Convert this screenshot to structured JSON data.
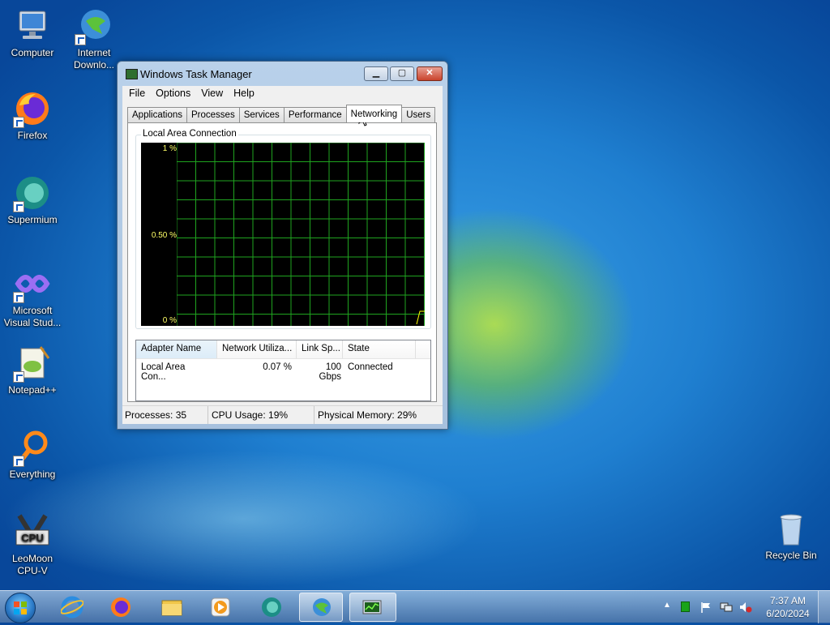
{
  "desktop": {
    "icons": [
      {
        "label": "Computer",
        "icon": "computer-icon"
      },
      {
        "label": "Internet Downlo...",
        "icon": "internet-download-manager-icon"
      },
      {
        "label": "Firefox",
        "icon": "firefox-icon"
      },
      {
        "label": "Supermium",
        "icon": "supermium-icon"
      },
      {
        "label": "Microsoft Visual Stud...",
        "icon": "visual-studio-icon"
      },
      {
        "label": "Notepad++",
        "icon": "notepad-plus-plus-icon"
      },
      {
        "label": "Everything",
        "icon": "everything-search-icon"
      },
      {
        "label": "LeoMoon CPU-V",
        "icon": "leomoon-cpu-v-icon"
      },
      {
        "label": "Recycle Bin",
        "icon": "recycle-bin-icon"
      }
    ]
  },
  "window": {
    "title": "Windows Task Manager",
    "menu": [
      "File",
      "Options",
      "View",
      "Help"
    ],
    "tabs": [
      "Applications",
      "Processes",
      "Services",
      "Performance",
      "Networking",
      "Users"
    ],
    "active_tab": "Networking",
    "graph": {
      "title": "Local Area Connection",
      "y_labels": [
        "1 %",
        "0.50 %",
        "0 %"
      ],
      "grid_color": "#1fa31f",
      "line_color": "#ffff00"
    },
    "adapters": {
      "columns": [
        "Adapter Name",
        "Network Utiliza...",
        "Link Sp...",
        "State"
      ],
      "rows": [
        [
          "Local Area Con...",
          "0.07 %",
          "100 Gbps",
          "Connected"
        ]
      ]
    },
    "status": {
      "processes": "Processes: 35",
      "cpu": "CPU Usage: 19%",
      "memory": "Physical Memory: 29%"
    }
  },
  "taskbar": {
    "pinned": [
      "internet-explorer-icon",
      "firefox-icon",
      "file-explorer-icon",
      "media-player-icon",
      "supermium-icon",
      "internet-download-manager-icon",
      "task-manager-icon"
    ],
    "clock_time": "7:37 AM",
    "clock_date": "6/20/2024"
  }
}
